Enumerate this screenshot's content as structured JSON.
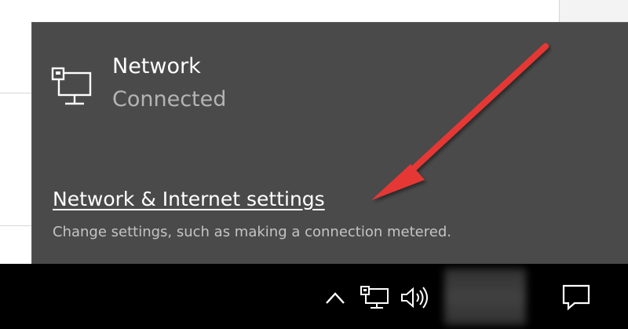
{
  "network": {
    "name": "Network",
    "status": "Connected"
  },
  "settings": {
    "link_label": "Network & Internet settings",
    "description": "Change settings, such as making a connection metered."
  },
  "taskbar": {
    "icons": [
      "chevron-up-icon",
      "network-icon",
      "volume-icon",
      "action-center-icon"
    ]
  },
  "colors": {
    "flyout_bg": "#4a4a4a",
    "taskbar_bg": "#000000",
    "arrow": "#e53935"
  }
}
